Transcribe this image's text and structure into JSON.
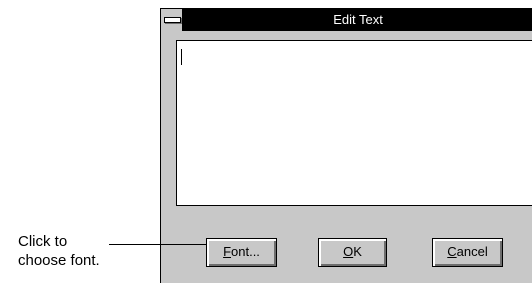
{
  "window": {
    "title": "Edit Text",
    "text_value": ""
  },
  "buttons": {
    "font": {
      "accel": "F",
      "rest": "ont..."
    },
    "ok": {
      "accel": "O",
      "rest": "K"
    },
    "cancel": {
      "accel": "C",
      "rest": "ancel"
    }
  },
  "callout": {
    "line1": "Click to",
    "line2": "choose font."
  },
  "icons": {
    "system_menu": "system-menu-icon"
  }
}
